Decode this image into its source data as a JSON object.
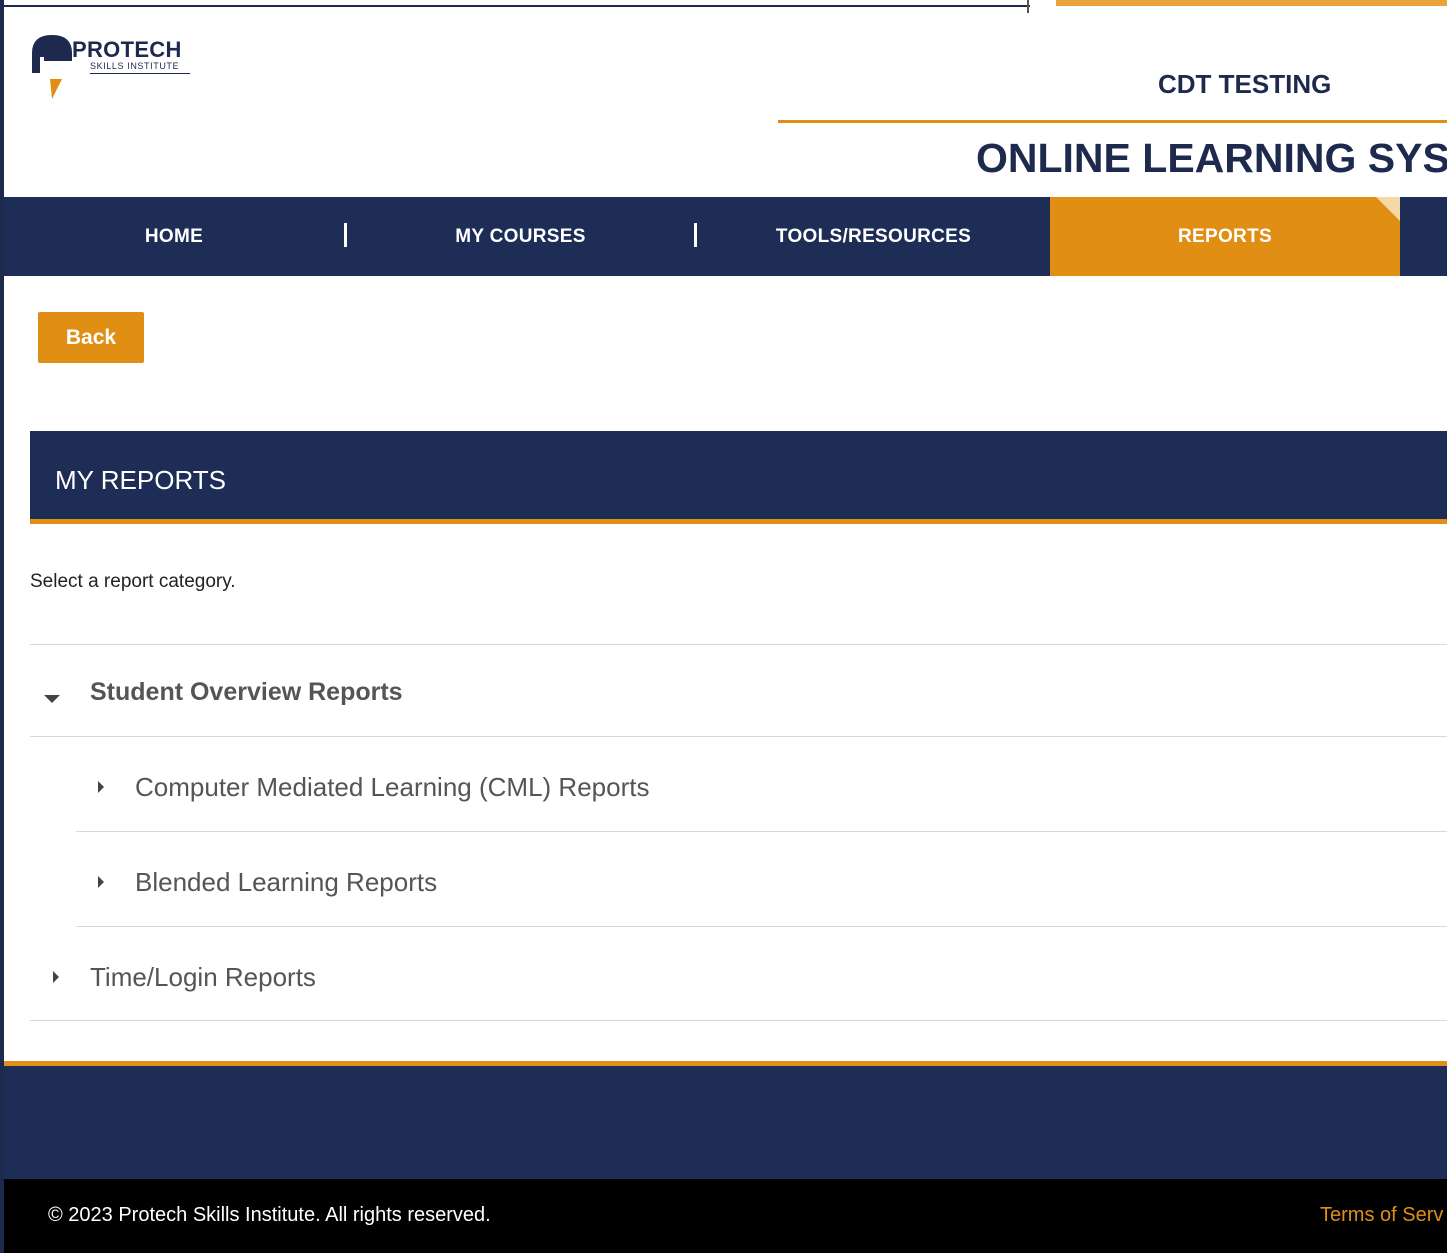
{
  "brand": {
    "logo_name_pro": "PRO",
    "logo_name_tech": "TECH",
    "logo_subtitle": "SKILLS INSTITUTE"
  },
  "header": {
    "org_name": "CDT TESTING",
    "system_title": "ONLINE LEARNING SYST"
  },
  "nav": {
    "home": "HOME",
    "my_courses": "MY COURSES",
    "tools": "TOOLS/RESOURCES",
    "reports": "REPORTS",
    "separator": "|"
  },
  "actions": {
    "back_label": "Back"
  },
  "reports": {
    "title": "MY REPORTS",
    "prompt": "Select a report category.",
    "categories": [
      {
        "label": "Student Overview Reports",
        "expanded": true,
        "children": [
          {
            "label": "Computer Mediated Learning (CML) Reports"
          },
          {
            "label": "Blended Learning Reports"
          }
        ]
      },
      {
        "label": "Time/Login Reports",
        "expanded": false
      }
    ]
  },
  "footer": {
    "copyright": "© 2023 Protech Skills Institute. All rights reserved.",
    "terms": "Terms of Serv"
  },
  "colors": {
    "navy": "#1d2d55",
    "orange": "#e08f14"
  }
}
